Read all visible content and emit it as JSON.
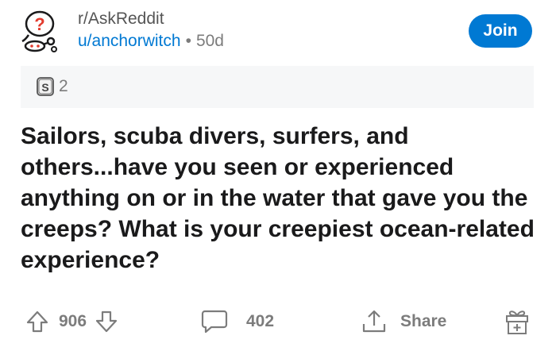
{
  "post": {
    "subreddit": "r/AskReddit",
    "author": "u/anchorwitch",
    "separator": "•",
    "age": "50d",
    "join_label": "Join",
    "award_count": "2",
    "title": "Sailors, scuba divers, surfers, and others...have you seen or experienced anything on or in the water that gave you the creeps? What is your creepiest ocean-related experience?"
  },
  "actions": {
    "upvotes": "906",
    "comments": "402",
    "share_label": "Share"
  },
  "colors": {
    "accent": "#0079d3",
    "muted": "#7c7c7c",
    "award_bg": "#f6f7f8"
  },
  "icons": [
    "askreddit-snoo-icon",
    "silver-award-icon",
    "upvote-arrow-icon",
    "downvote-arrow-icon",
    "comment-bubble-icon",
    "share-icon",
    "gift-award-icon"
  ]
}
